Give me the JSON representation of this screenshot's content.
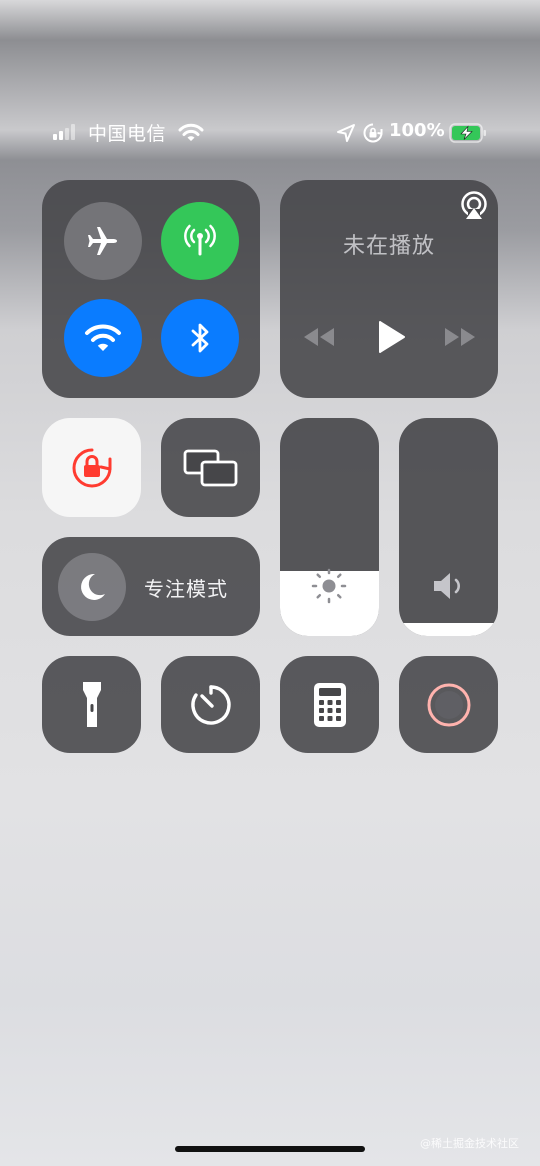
{
  "status_bar": {
    "carrier": "中国电信",
    "signal_bars": 2,
    "signal_total": 4,
    "battery_percent": "100%",
    "battery_color": "#34c759",
    "icons": [
      "wifi-icon",
      "location-arrow-icon",
      "orientation-lock-icon",
      "battery-charging-icon"
    ]
  },
  "connectivity": {
    "airplane": {
      "icon": "airplane-icon",
      "state": "off"
    },
    "cellular": {
      "icon": "antenna-icon",
      "state": "on",
      "color": "#34c759"
    },
    "wifi": {
      "icon": "wifi-icon",
      "state": "on",
      "color": "#0a7cff"
    },
    "bluetooth": {
      "icon": "bluetooth-icon",
      "state": "on",
      "color": "#0a7cff"
    }
  },
  "now_playing": {
    "title": "未在播放",
    "icons": [
      "airplay-icon",
      "rewind-icon",
      "play-icon",
      "fast-forward-icon"
    ]
  },
  "controls": {
    "orientation_lock": {
      "icon": "orientation-lock-icon",
      "state": "on",
      "color": "#ff3b30"
    },
    "screen_mirroring": {
      "icon": "screen-mirroring-icon"
    },
    "focus": {
      "icon": "moon-icon",
      "label": "专注模式"
    },
    "brightness": {
      "icon": "sun-icon",
      "level": 0.3
    },
    "volume": {
      "icon": "speaker-icon",
      "level": 0.06
    },
    "flashlight": {
      "icon": "flashlight-icon"
    },
    "timer": {
      "icon": "timer-icon"
    },
    "calculator": {
      "icon": "calculator-icon"
    },
    "screen_recording": {
      "icon": "record-icon"
    }
  },
  "watermark": "@稀土掘金技术社区"
}
